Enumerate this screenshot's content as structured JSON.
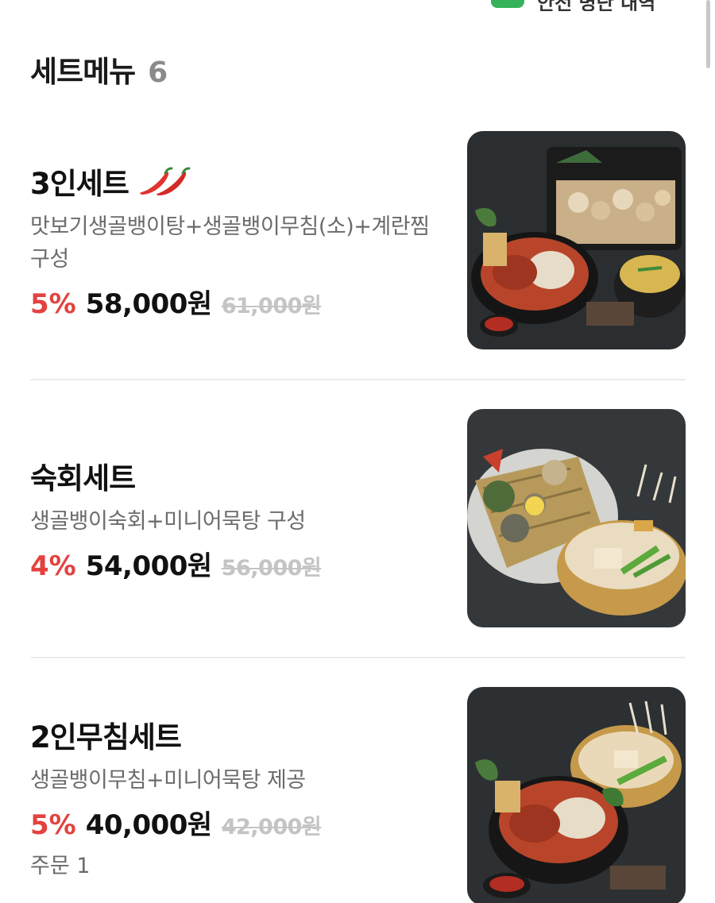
{
  "top_bar": {
    "text": "안전 명단 내역"
  },
  "section": {
    "title": "세트메뉴",
    "count": "6"
  },
  "items": [
    {
      "name": "3인세트",
      "spicy_icon": "chili-pepper-icon",
      "description": "맛보기생골뱅이탕+생골뱅이무침(소)+계란찜구성",
      "discount": "5%",
      "price": "58,000원",
      "original_price": "61,000원"
    },
    {
      "name": "숙회세트",
      "description": "생골뱅이숙회+미니어묵탕 구성",
      "discount": "4%",
      "price": "54,000원",
      "original_price": "56,000원"
    },
    {
      "name": "2인무침세트",
      "description": "생골뱅이무침+미니어묵탕 제공",
      "discount": "5%",
      "price": "40,000원",
      "original_price": "42,000원",
      "order_count": "주문 1"
    }
  ],
  "colors": {
    "discount": "#e3423f",
    "original_price": "#c4c4c4",
    "description": "#6b6b6b",
    "divider": "#ececec"
  }
}
